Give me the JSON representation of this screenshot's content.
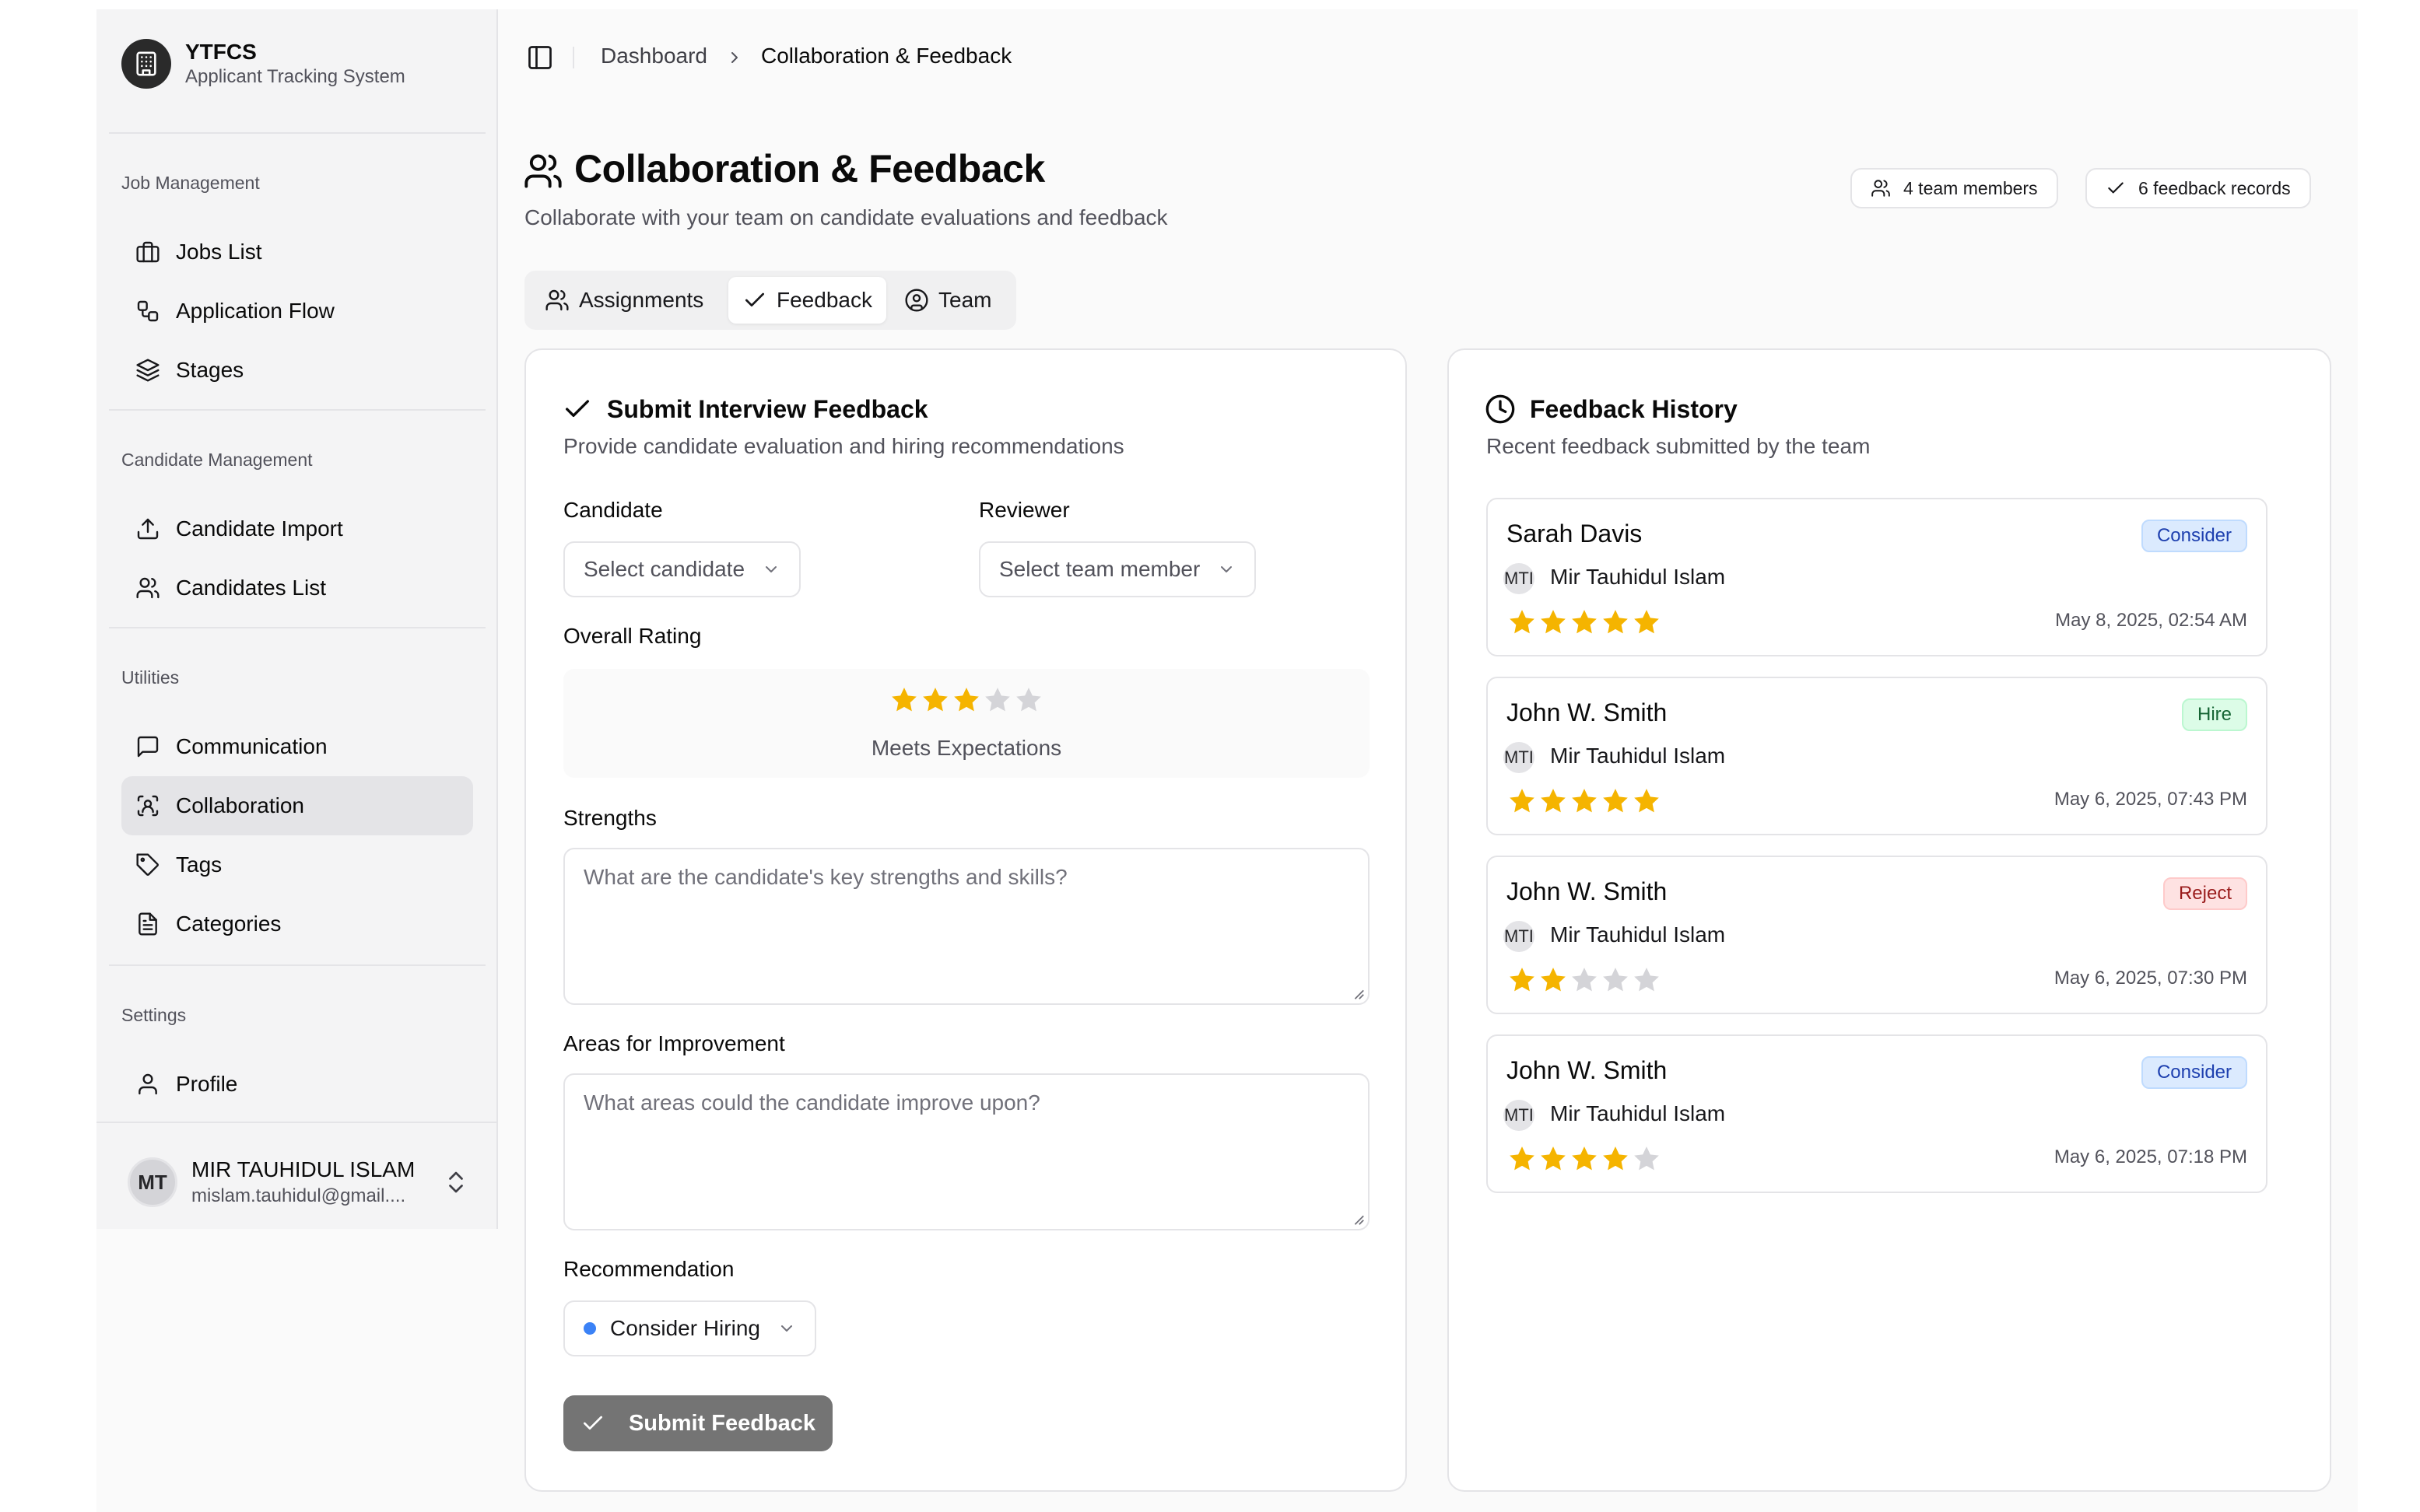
{
  "brand": {
    "name": "YTFCS",
    "subtitle": "Applicant Tracking System"
  },
  "sidebar": {
    "groups": [
      {
        "title": "Job Management",
        "items": [
          {
            "label": "Jobs List",
            "icon": "briefcase-icon"
          },
          {
            "label": "Application Flow",
            "icon": "workflow-icon"
          },
          {
            "label": "Stages",
            "icon": "layers-icon"
          }
        ]
      },
      {
        "title": "Candidate Management",
        "items": [
          {
            "label": "Candidate Import",
            "icon": "upload-icon"
          },
          {
            "label": "Candidates List",
            "icon": "users-icon"
          }
        ]
      },
      {
        "title": "Utilities",
        "items": [
          {
            "label": "Communication",
            "icon": "message-icon"
          },
          {
            "label": "Collaboration",
            "icon": "collaboration-icon",
            "active": true
          },
          {
            "label": "Tags",
            "icon": "tag-icon"
          },
          {
            "label": "Categories",
            "icon": "file-icon"
          }
        ]
      },
      {
        "title": "Settings",
        "items": [
          {
            "label": "Profile",
            "icon": "user-icon"
          }
        ]
      }
    ],
    "user": {
      "initials": "MT",
      "name": "MIR TAUHIDUL ISLAM",
      "email": "mislam.tauhidul@gmail...."
    }
  },
  "breadcrumb": {
    "items": [
      "Dashboard",
      "Collaboration & Feedback"
    ]
  },
  "header": {
    "title": "Collaboration & Feedback",
    "subtitle": "Collaborate with your team on candidate evaluations and feedback",
    "team_members": "4 team members",
    "feedback_records": "6 feedback records"
  },
  "tabs": [
    {
      "label": "Assignments",
      "icon": "users-icon"
    },
    {
      "label": "Feedback",
      "icon": "check-icon",
      "active": true
    },
    {
      "label": "Team",
      "icon": "user-circle-icon"
    }
  ],
  "form": {
    "title": "Submit Interview Feedback",
    "subtitle": "Provide candidate evaluation and hiring recommendations",
    "candidate_label": "Candidate",
    "candidate_placeholder": "Select candidate",
    "reviewer_label": "Reviewer",
    "reviewer_placeholder": "Select team member",
    "rating_label": "Overall Rating",
    "rating": 3,
    "rating_max": 5,
    "rating_text": "Meets Expectations",
    "strengths_label": "Strengths",
    "strengths_placeholder": "What are the candidate's key strengths and skills?",
    "improvement_label": "Areas for Improvement",
    "improvement_placeholder": "What areas could the candidate improve upon?",
    "recommendation_label": "Recommendation",
    "recommendation_value": "Consider Hiring",
    "recommendation_color": "#3b82f6",
    "submit_label": "Submit Feedback"
  },
  "history": {
    "title": "Feedback History",
    "subtitle": "Recent feedback submitted by the team",
    "items": [
      {
        "candidate": "Sarah Davis",
        "badge": "Consider",
        "badge_type": "consider",
        "reviewer_initials": "MTI",
        "reviewer": "Mir Tauhidul Islam",
        "rating": 5,
        "date": "May 8, 2025, 02:54 AM"
      },
      {
        "candidate": "John W. Smith",
        "badge": "Hire",
        "badge_type": "hire",
        "reviewer_initials": "MTI",
        "reviewer": "Mir Tauhidul Islam",
        "rating": 5,
        "date": "May 6, 2025, 07:43 PM"
      },
      {
        "candidate": "John W. Smith",
        "badge": "Reject",
        "badge_type": "reject",
        "reviewer_initials": "MTI",
        "reviewer": "Mir Tauhidul Islam",
        "rating": 2,
        "date": "May 6, 2025, 07:30 PM"
      },
      {
        "candidate": "John W. Smith",
        "badge": "Consider",
        "badge_type": "consider",
        "reviewer_initials": "MTI",
        "reviewer": "Mir Tauhidul Islam",
        "rating": 4,
        "date": "May 6, 2025, 07:18 PM"
      }
    ]
  },
  "colors": {
    "star_filled": "#f5b400",
    "star_empty": "#d4d4d8"
  }
}
